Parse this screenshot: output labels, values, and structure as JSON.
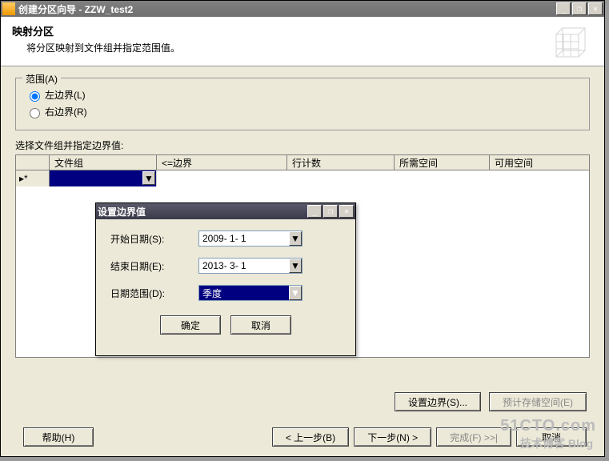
{
  "window": {
    "title": "创建分区向导 - ZZW_test2",
    "min": "_",
    "restore": "❐",
    "close": "✕"
  },
  "header": {
    "title": "映射分区",
    "subtitle": "将分区映射到文件组并指定范围值。"
  },
  "range_group": {
    "legend": "范围(A)",
    "left": "左边界(L)",
    "right": "右边界(R)"
  },
  "grid_label": "选择文件组并指定边界值:",
  "columns": {
    "filegroup": "文件组",
    "boundary": "<=边界",
    "rowcount": "行计数",
    "reqspace": "所需空间",
    "availspace": "可用空间"
  },
  "row_indicator": "▸*",
  "buttons": {
    "set_boundary": "设置边界(S)...",
    "estimate": "预计存储空间(E)",
    "help": "帮助(H)",
    "back": "< 上一步(B)",
    "next": "下一步(N) >",
    "finish": "完成(F) >>|",
    "cancel": "取消"
  },
  "dialog": {
    "title": "设置边界值",
    "start_label": "开始日期(S):",
    "start_value": "2009- 1- 1",
    "end_label": "结束日期(E):",
    "end_value": "2013- 3- 1",
    "range_label": "日期范围(D):",
    "range_value": "季度",
    "ok": "确定",
    "cancel": "取消"
  },
  "watermark": "51CTO.com",
  "watermark2": "技术博客 Blog"
}
